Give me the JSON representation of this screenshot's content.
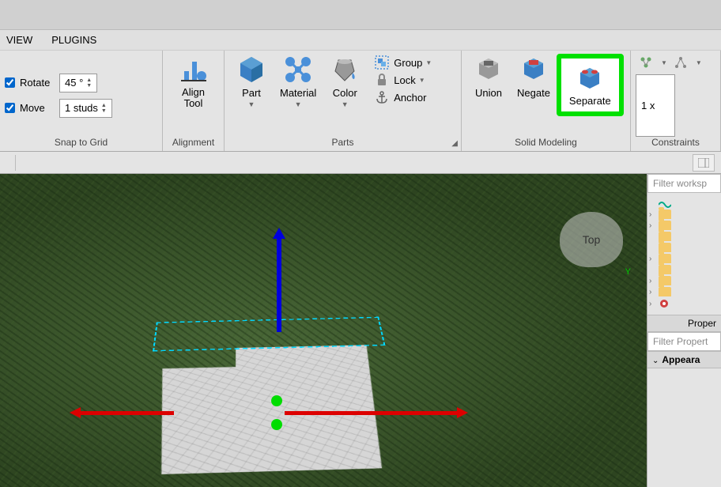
{
  "menus": {
    "view": "VIEW",
    "plugins": "PLUGINS"
  },
  "snap": {
    "rotate_label": "Rotate",
    "rotate_value": "45 °",
    "move_label": "Move",
    "move_value": "1 studs",
    "group_label": "Snap to Grid"
  },
  "alignment": {
    "btn": "Align Tool",
    "group_label": "Alignment"
  },
  "parts": {
    "part": "Part",
    "material": "Material",
    "color": "Color",
    "group": "Group",
    "lock": "Lock",
    "anchor": "Anchor",
    "group_label": "Parts"
  },
  "solid": {
    "union": "Union",
    "negate": "Negate",
    "separate": "Separate",
    "group_label": "Solid Modeling"
  },
  "constraints": {
    "mult_value": "1 x",
    "group_label": "Constraints"
  },
  "viewport": {
    "cube_face": "Top",
    "axis": "Y"
  },
  "explorer": {
    "filter_placeholder": "Filter worksp",
    "properties_label": "Proper",
    "filter_properties_placeholder": "Filter Propert",
    "appearance_label": "Appeara"
  }
}
